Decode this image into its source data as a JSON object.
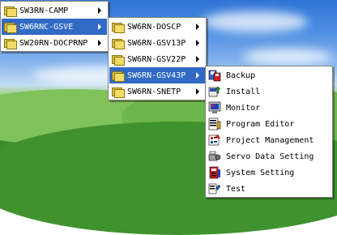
{
  "menu_level1": [
    {
      "label": "SW3RN-CAMP",
      "selected": false
    },
    {
      "label": "SW6RNC-GSVE",
      "selected": true
    },
    {
      "label": "SW20RN-DOCPRNP",
      "selected": false
    }
  ],
  "menu_level2": [
    {
      "label": "SW6RN-DOSCP",
      "selected": false
    },
    {
      "label": "SW6RN-GSV13P",
      "selected": false
    },
    {
      "label": "SW6RN-GSV22P",
      "selected": false
    },
    {
      "label": "SW6RN-GSV43P",
      "selected": true
    },
    {
      "label": "SW6RN-SNETP",
      "selected": false
    }
  ],
  "menu_level3": [
    {
      "label": "Backup",
      "icon": "backup-icon"
    },
    {
      "label": "Install",
      "icon": "install-icon"
    },
    {
      "label": "Monitor",
      "icon": "monitor-icon"
    },
    {
      "label": "Program Editor",
      "icon": "program-editor-icon"
    },
    {
      "label": "Project Management",
      "icon": "project-management-icon"
    },
    {
      "label": "Servo Data Setting",
      "icon": "servo-data-icon"
    },
    {
      "label": "System Setting",
      "icon": "system-setting-icon"
    },
    {
      "label": "Test",
      "icon": "test-icon"
    }
  ],
  "colors": {
    "selection": "#316ac5",
    "menu_bg": "#ffffff"
  }
}
